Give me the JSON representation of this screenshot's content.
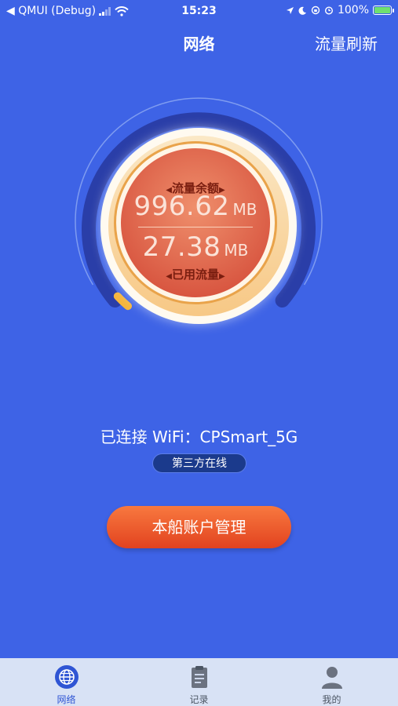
{
  "status_bar": {
    "back_label": "◀ QMUI (Debug)",
    "time": "15:23",
    "battery": "100%",
    "battery_level": 1.0
  },
  "nav": {
    "title": "网络",
    "right_action": "流量刷新"
  },
  "gauge": {
    "remaining_label": "流量余额",
    "remaining_value": "996.62",
    "remaining_unit": "MB",
    "used_value": "27.38",
    "used_unit": "MB",
    "used_label": "已用流量"
  },
  "wifi": {
    "text": "已连接 WiFi：CPSmart_5G",
    "badge": "第三方在线"
  },
  "account_button": "本船账户管理",
  "tabs": [
    {
      "label": "网络",
      "icon": "globe-icon",
      "active": true
    },
    {
      "label": "记录",
      "icon": "clipboard-icon",
      "active": false
    },
    {
      "label": "我的",
      "icon": "user-icon",
      "active": false
    }
  ],
  "colors": {
    "background": "#3e63e6",
    "tab_active": "#2f55d4",
    "tab_inactive": "#6b7280",
    "button": "#e2421f"
  }
}
